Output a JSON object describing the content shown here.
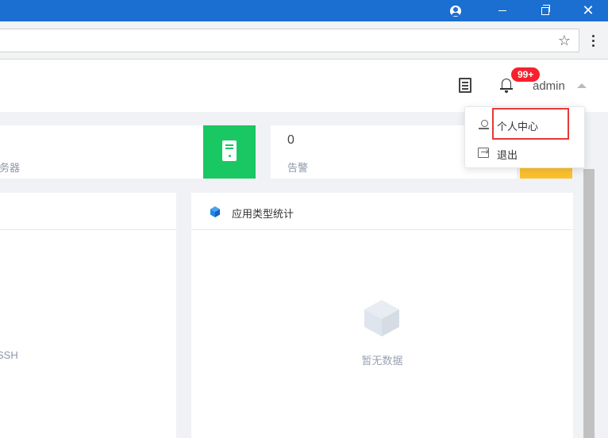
{
  "header": {
    "username": "admin",
    "notification_badge": "99+"
  },
  "stats": {
    "server_label": "服务器",
    "alert_value": "0",
    "alert_label": "告警"
  },
  "panels": {
    "left": {
      "label": "SSH"
    },
    "right": {
      "title": "应用类型统计",
      "empty_text": "暂无数据"
    }
  },
  "dropdown": {
    "items": [
      {
        "label": "个人中心",
        "icon": "user-icon"
      },
      {
        "label": "退出",
        "icon": "logout-icon"
      }
    ]
  },
  "colors": {
    "titlebar": "#1a6fd0",
    "server_tile": "#19c763",
    "alert_tile": "#fbc02d",
    "badge": "#f5222d",
    "highlight": "#e53935"
  }
}
